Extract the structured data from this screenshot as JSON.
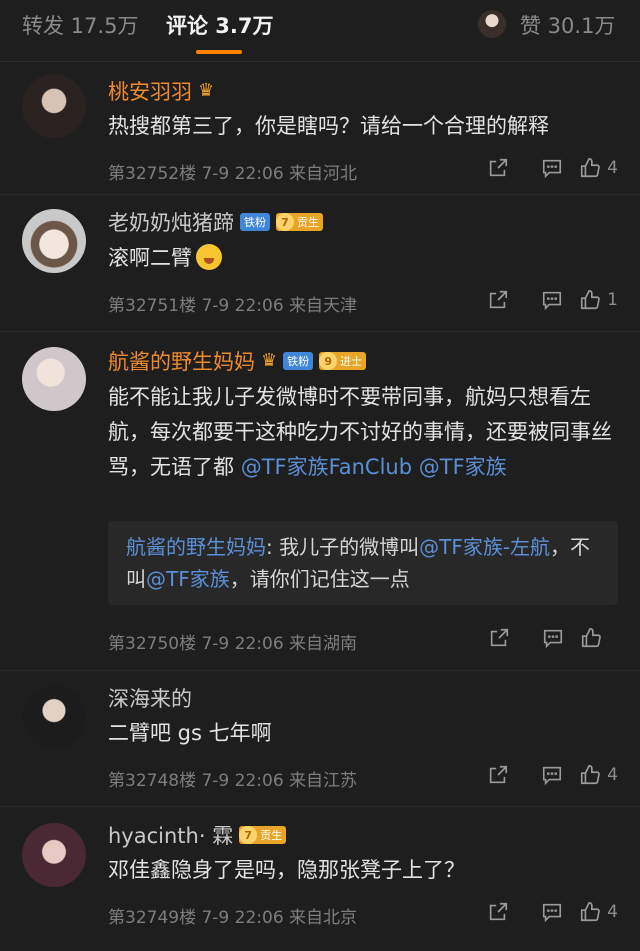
{
  "tabs": {
    "repost": "转发 17.5万",
    "comments": "评论 3.7万",
    "likes": "赞 30.1万"
  },
  "colors": {
    "accent": "#ff8200",
    "mention": "#5b8fd6",
    "orange_name": "#f08a2c"
  },
  "comments": [
    {
      "username": "桃安羽羽",
      "text": "热搜都第三了，你是瞎吗？请给一个合理的解释",
      "meta": "第32752楼 7-9 22:06 来自河北",
      "likes": "4"
    },
    {
      "username": "老奶奶炖猪蹄",
      "fan_badge": "铁粉",
      "level": "7",
      "level_title": "贡生",
      "text": "滚啊二臂",
      "meta": "第32751楼 7-9 22:06 来自天津",
      "likes": "1"
    },
    {
      "username": "航酱的野生妈妈",
      "fan_badge": "铁粉",
      "level": "9",
      "level_title": "进士",
      "text": "能不能让我儿子发微博时不要带同事，航妈只想看左航，每次都要干这种吃力不讨好的事情，还要被同事丝骂，无语了都",
      "mention1": "@TF家族FanClub",
      "mention2": "@TF家族",
      "quote_name": "航酱的野生妈妈",
      "quote_text1": ": 我儿子的微博叫",
      "quote_mention1": "@TF家族-左航",
      "quote_text2": "，不叫",
      "quote_mention2": "@TF家族",
      "quote_text3": "，请你们记住这一点",
      "meta": "第32750楼 7-9 22:06 来自湖南",
      "likes": ""
    },
    {
      "username": "深海来的",
      "text": "二臂吧 gs 七年啊",
      "meta": "第32748楼 7-9 22:06 来自江苏",
      "likes": "4"
    },
    {
      "username": "hyacinth· 霖",
      "level": "7",
      "level_title": "贡生",
      "text": "邓佳鑫隐身了是吗，隐那张凳子上了？",
      "meta": "第32749楼 7-9 22:06 来自北京",
      "likes": "4"
    }
  ]
}
